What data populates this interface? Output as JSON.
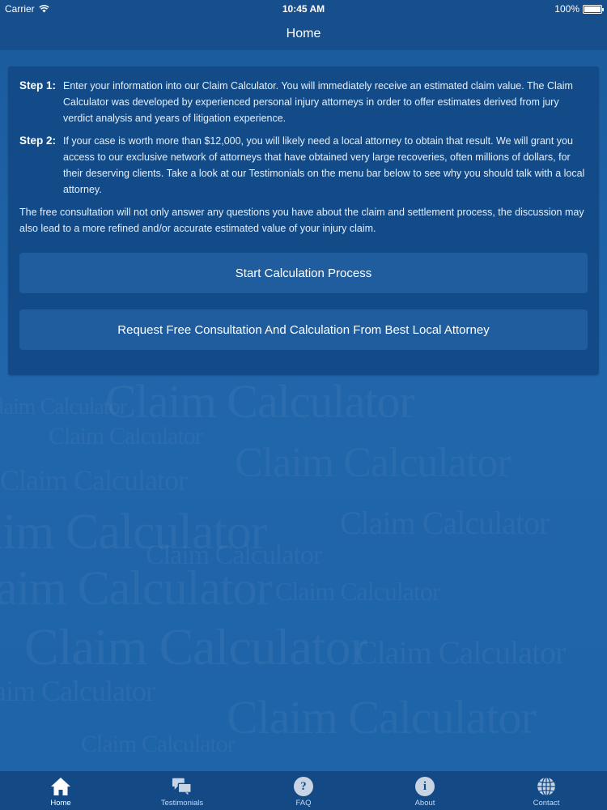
{
  "status_bar": {
    "carrier": "Carrier",
    "time": "10:45 AM",
    "battery": "100%"
  },
  "nav": {
    "title": "Home"
  },
  "content": {
    "step1": {
      "label": "Step 1:",
      "text": "Enter your information into our Claim Calculator. You will immediately receive an estimated claim value. The Claim Calculator was developed by experienced personal injury attorneys in order to offer estimates derived from jury verdict analysis and years of litigation experience."
    },
    "step2": {
      "label": "Step 2:",
      "text": "If your case is worth more than $12,000, you will likely need a local attorney to obtain that result. We will grant you access to our exclusive network of attorneys that have obtained very large recoveries, often millions of dollars, for their deserving clients. Take a look at our Testimonials on the menu bar below to see why you should talk with a local attorney."
    },
    "paragraph": "The free consultation will not only answer any questions you have about the claim and settlement process, the discussion may also lead to a more refined and/or accurate estimated value of your injury claim.",
    "start_button": "Start Calculation Process",
    "consult_button": "Request Free Consultation And Calculation From Best Local Attorney"
  },
  "watermark_text": "Claim Calculator",
  "tabs": [
    {
      "label": "Home",
      "icon": "home-icon",
      "active": true
    },
    {
      "label": "Testimonials",
      "icon": "chat-bubbles-icon",
      "active": false
    },
    {
      "label": "FAQ",
      "icon": "question-icon",
      "active": false
    },
    {
      "label": "About",
      "icon": "info-icon",
      "active": false
    },
    {
      "label": "Contact",
      "icon": "globe-icon",
      "active": false
    }
  ],
  "colors": {
    "background": "#1f64a6",
    "bar": "#174f8c",
    "card": "#134b88",
    "button": "#205d9e"
  }
}
